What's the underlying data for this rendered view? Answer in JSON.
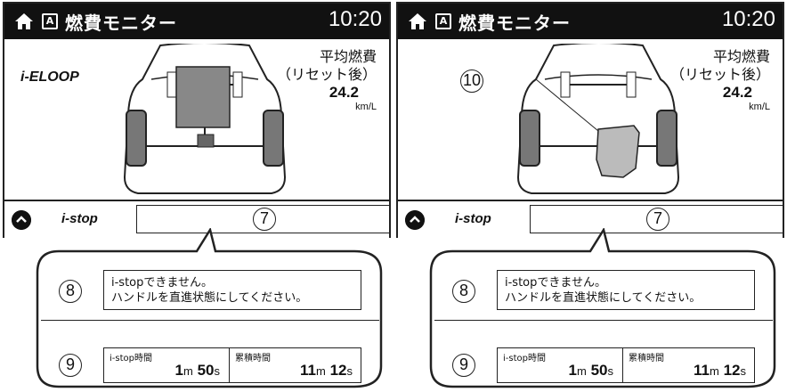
{
  "screens": [
    {
      "header": {
        "title": "燃費モニター",
        "time": "10:20",
        "badge": "A"
      },
      "system_label": "i-ELOOP",
      "avg": {
        "line1": "平均燃費",
        "line2": "（リセット後）",
        "value": "24.2",
        "unit": "km/L"
      },
      "istop_label": "i-stop",
      "callout_7": "7",
      "callout_8": "8",
      "callout_9": "9",
      "message": {
        "line1": "i-stopできません。",
        "line2": "ハンドルを直進状態にしてください。"
      },
      "time_a": {
        "label": "i-stop時間",
        "min": "1",
        "min_unit": "m",
        "sec": "50",
        "sec_unit": "s"
      },
      "time_b": {
        "label": "累積時間",
        "min": "11",
        "min_unit": "m",
        "sec": "12",
        "sec_unit": "s"
      }
    },
    {
      "header": {
        "title": "燃費モニター",
        "time": "10:20",
        "badge": "A"
      },
      "callout_10": "10",
      "avg": {
        "line1": "平均燃費",
        "line2": "（リセット後）",
        "value": "24.2",
        "unit": "km/L"
      },
      "istop_label": "i-stop",
      "callout_7": "7",
      "callout_8": "8",
      "callout_9": "9",
      "message": {
        "line1": "i-stopできません。",
        "line2": "ハンドルを直進状態にしてください。"
      },
      "time_a": {
        "label": "i-stop時間",
        "min": "1",
        "min_unit": "m",
        "sec": "50",
        "sec_unit": "s"
      },
      "time_b": {
        "label": "累積時間",
        "min": "11",
        "min_unit": "m",
        "sec": "12",
        "sec_unit": "s"
      }
    }
  ],
  "colors": {
    "header_bg": "#111111",
    "battery": "#888888",
    "engine": "#bbbbbb"
  }
}
